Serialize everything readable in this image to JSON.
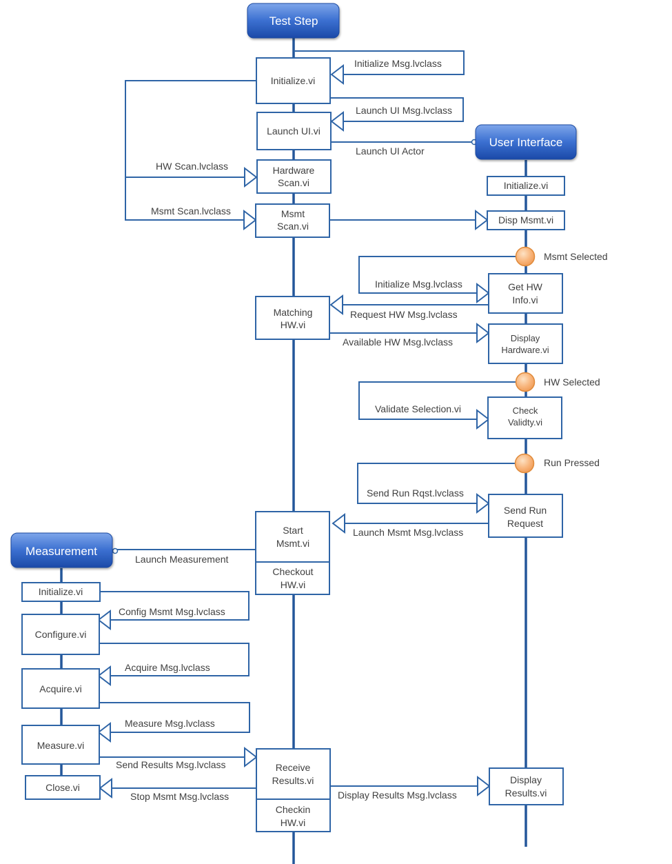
{
  "actors": {
    "test_step": "Test Step",
    "user_interface": "User Interface",
    "measurement": "Measurement"
  },
  "test_step_boxes": {
    "initialize": "Initialize.vi",
    "launch_ui": "Launch UI.vi",
    "hardware_scan": [
      "Hardware",
      "Scan.vi"
    ],
    "msmt_scan": [
      "Msmt",
      "Scan.vi"
    ],
    "matching_hw": [
      "Matching",
      "HW.vi"
    ],
    "start_msmt": [
      "Start",
      "Msmt.vi"
    ],
    "checkout_hw": [
      "Checkout",
      "HW.vi"
    ],
    "receive_results": [
      "Receive",
      "Results.vi"
    ],
    "checkin_hw": [
      "Checkin",
      "HW.vi"
    ]
  },
  "ui_boxes": {
    "initialize": "Initialize.vi",
    "disp_msmt": "Disp Msmt.vi",
    "get_hw_info": [
      "Get HW",
      "Info.vi"
    ],
    "display_hardware": [
      "Display",
      "Hardware.vi"
    ],
    "check_validity": [
      "Check",
      "Validty.vi"
    ],
    "send_run_request": [
      "Send Run",
      "Request"
    ],
    "display_results": [
      "Display",
      "Results.vi"
    ]
  },
  "measurement_boxes": {
    "initialize": "Initialize.vi",
    "configure": "Configure.vi",
    "acquire": "Acquire.vi",
    "measure": "Measure.vi",
    "close": "Close.vi"
  },
  "events": {
    "msmt_selected": "Msmt Selected",
    "hw_selected": "HW Selected",
    "run_pressed": "Run Pressed"
  },
  "messages": {
    "initialize_msg": "Initialize Msg.lvclass",
    "launch_ui_msg": "Launch UI Msg.lvclass",
    "launch_ui_actor": "Launch UI Actor",
    "hw_scan": "HW Scan.lvclass",
    "msmt_scan": "Msmt Scan.lvclass",
    "ui_initialize_msg": "Initialize Msg.lvclass",
    "request_hw_msg": "Request  HW Msg.lvclass",
    "available_hw_msg": "Available HW Msg.lvclass",
    "validate_selection": "Validate Selection.vi",
    "send_run_rqst": "Send Run Rqst.lvclass",
    "launch_msmt_msg": "Launch Msmt Msg.lvclass",
    "launch_measurement": "Launch Measurement",
    "config_msmt_msg": "Config Msmt Msg.lvclass",
    "acquire_msg": "Acquire Msg.lvclass",
    "measure_msg": "Measure Msg.lvclass",
    "send_results_msg": "Send Results  Msg.lvclass",
    "stop_msmt_msg": "Stop Msmt Msg.lvclass",
    "display_results_msg": "Display Results  Msg.lvclass"
  }
}
